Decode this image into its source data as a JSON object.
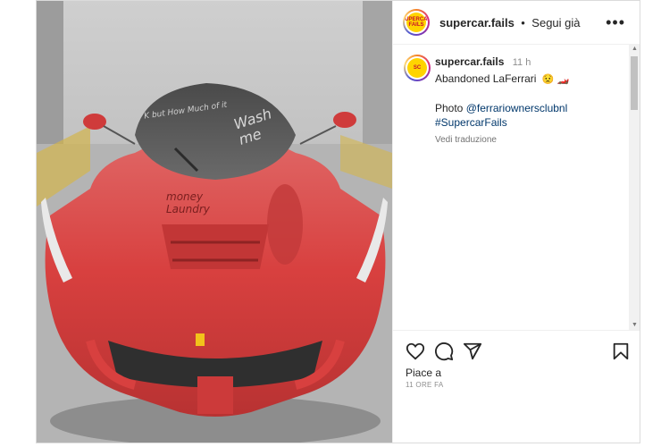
{
  "header": {
    "username": "supercar.fails",
    "separator": "•",
    "follow_label": "Segui già",
    "more_icon": "more-horizontal-icon"
  },
  "avatar": {
    "logo_text": "SUPERCAR FAILS"
  },
  "caption": {
    "username": "supercar.fails",
    "time_ago": "11 h",
    "text": "Abandoned LaFerrari",
    "emojis": "😟 🏎️",
    "photo_label": "Photo",
    "photo_credit": "@ferrariownersclubnl",
    "hashtag": "#SupercarFails",
    "translate_label": "Vedi traduzione"
  },
  "actions": {
    "like_icon": "heart-icon",
    "comment_icon": "comment-icon",
    "share_icon": "send-icon",
    "save_icon": "bookmark-icon",
    "likes_text": "Piace a",
    "timestamp": "11 ORE FA"
  },
  "photo": {
    "scribble_1": "money Laundry",
    "scribble_2": "Wash me",
    "scribble_3": "K but How Much of it",
    "colors": {
      "car_red": "#d8403f",
      "dust": "#5b5b5b",
      "floor": "#b9b9b9"
    }
  }
}
